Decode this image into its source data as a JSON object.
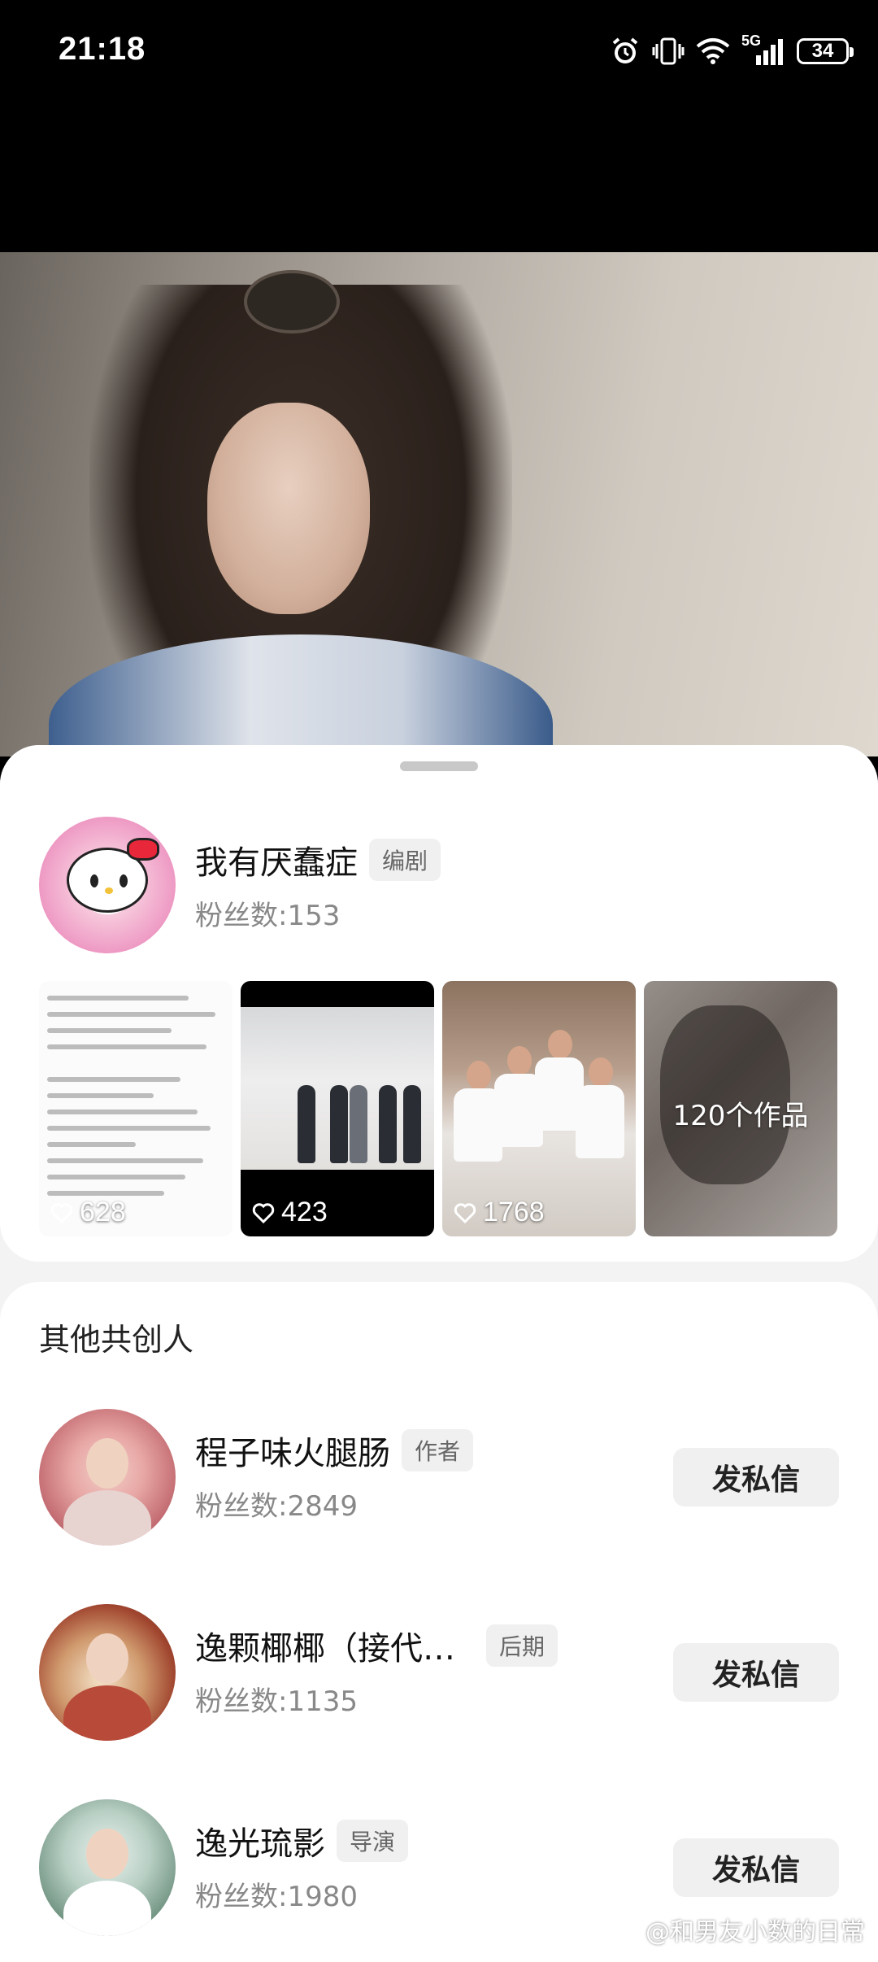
{
  "status_bar": {
    "time": "21:18",
    "network": "5G",
    "battery": "34"
  },
  "creator": {
    "name": "我有厌蠢症",
    "role": "编剧",
    "fans": "粉丝数:153",
    "works": [
      {
        "likes": "628"
      },
      {
        "likes": "423"
      },
      {
        "likes": "1768"
      },
      {
        "count_label": "120个作品"
      }
    ]
  },
  "cocreators": {
    "title": "其他共创人",
    "items": [
      {
        "name": "程子味火腿肠",
        "role": "作者",
        "fans": "粉丝数:2849",
        "button": "发私信"
      },
      {
        "name": "逸颗椰椰（接代…",
        "role": "后期",
        "fans": "粉丝数:1135",
        "button": "发私信"
      },
      {
        "name": "逸光琉影",
        "role": "导演",
        "fans": "粉丝数:1980",
        "button": "发私信"
      }
    ]
  },
  "watermark": "@和男友小数的日常"
}
